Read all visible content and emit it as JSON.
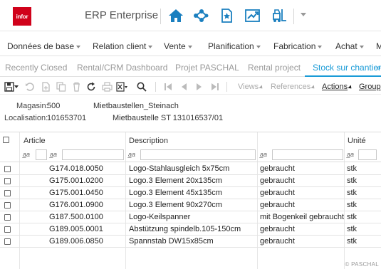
{
  "header": {
    "logo_text": "infor",
    "app_title": "ERP Enterprise",
    "icons": [
      "home-icon",
      "network-icon",
      "favorites-icon",
      "chart-icon",
      "forklift-icon",
      "chevron-down-icon"
    ],
    "accent": "#d0021b",
    "icon_color": "#1a7fbf"
  },
  "menu": {
    "items": [
      {
        "label": "Données de base"
      },
      {
        "label": "Relation client"
      },
      {
        "label": "Vente"
      },
      {
        "label": "Planification"
      },
      {
        "label": "Fabrication"
      },
      {
        "label": "Achat"
      },
      {
        "label": "M"
      }
    ]
  },
  "tabs": {
    "items": [
      {
        "label": "Recently Closed",
        "active": false
      },
      {
        "label": "Rental/CRM Dashboard",
        "active": false
      },
      {
        "label": "Projet PASCHAL",
        "active": false
      },
      {
        "label": "Rental project",
        "active": false
      },
      {
        "label": "Stock sur chantier",
        "active": true
      }
    ],
    "active_color": "#1a9bd7",
    "more_symbol": "»"
  },
  "toolbar": {
    "icons": [
      "save-icon",
      "undo-icon",
      "new-icon",
      "copy-icon",
      "delete-icon",
      "refresh-icon",
      "print-icon",
      "excel-icon",
      "search-icon",
      "first-page-icon",
      "prev-page-icon",
      "next-page-icon",
      "last-page-icon"
    ],
    "views_label": "Views",
    "references_label": "References",
    "actions_label": "Actions",
    "group_label": "Group"
  },
  "info": {
    "magasin_label": "Magasin:",
    "magasin_code": "500",
    "magasin_name": "Mietbaustellen_Steinach",
    "localisation_label": "Localisation:",
    "localisation_code": "101653701",
    "localisation_name": "Mietbaustelle ST 131016537/01"
  },
  "grid": {
    "columns": {
      "article": "Article",
      "description": "Description",
      "unite": "Unité"
    },
    "filter_symbol": "a̲a",
    "rows": [
      {
        "article": "G174.018.0050",
        "description": "Logo-Stahlausgleich 5x75cm",
        "etat": "gebraucht",
        "unite": "stk"
      },
      {
        "article": "G175.001.0200",
        "description": "Logo.3 Element 20x135cm",
        "etat": "gebraucht",
        "unite": "stk"
      },
      {
        "article": "G175.001.0450",
        "description": "Logo.3 Element 45x135cm",
        "etat": "gebraucht",
        "unite": "stk"
      },
      {
        "article": "G176.001.0900",
        "description": "Logo.3 Element 90x270cm",
        "etat": "gebraucht",
        "unite": "stk"
      },
      {
        "article": "G187.500.0100",
        "description": "Logo-Keilspanner",
        "etat": "mit Bogenkeil gebraucht",
        "unite": "stk"
      },
      {
        "article": "G189.005.0001",
        "description": "Abstützung spindelb.105-150cm",
        "etat": "gebraucht",
        "unite": "stk"
      },
      {
        "article": "G189.006.0850",
        "description": "Spannstab DW15x85cm",
        "etat": "gebraucht",
        "unite": "stk"
      }
    ]
  },
  "footer": {
    "copyright": "© PASCHAL"
  }
}
